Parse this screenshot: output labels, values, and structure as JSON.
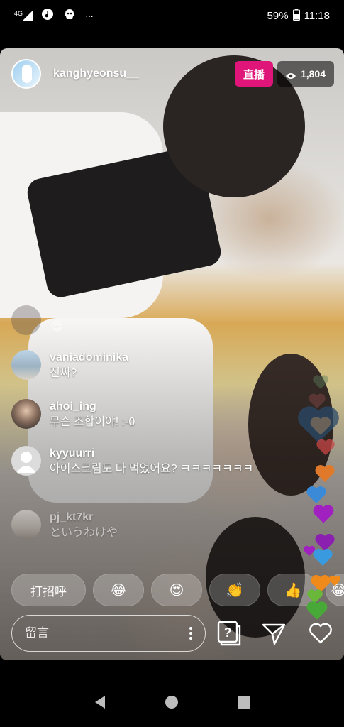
{
  "status_bar": {
    "network": "4G",
    "battery": "59%",
    "time": "11:18",
    "more": "···"
  },
  "live": {
    "username": "kanghyeonsu__",
    "badge": "直播",
    "viewer_count": "1,804",
    "accent_color": "#e0157a"
  },
  "comments": [
    {
      "user": "vaniadominika",
      "message": "진짜?"
    },
    {
      "user": "ahoi_ing",
      "message": "무슨 조합이야! :-0"
    },
    {
      "user": "kyyuurri",
      "message": "아이스크림도 다 먹었어요? ㅋㅋㅋㅋㅋㅋㅋ"
    },
    {
      "user": "pj_kt7kr",
      "message": "というわけや"
    }
  ],
  "reactions": {
    "greet": "打招呼",
    "emojis": [
      "😂",
      "😍",
      "👏",
      "👍",
      "😂"
    ]
  },
  "comment_bar": {
    "placeholder": "留言"
  },
  "icons": [
    "question-box-icon",
    "send-icon",
    "heart-icon",
    "back-icon",
    "home-icon",
    "recents-icon"
  ]
}
